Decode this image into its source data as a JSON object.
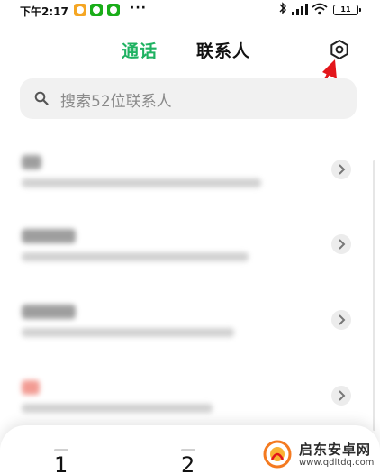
{
  "status_bar": {
    "time": "下午2:17",
    "more": "···",
    "battery": "11",
    "app_badges": [
      {
        "icon": "app-notification-icon",
        "color": "#f5a623"
      },
      {
        "icon": "wechat-icon",
        "color": "#1aad19"
      },
      {
        "icon": "wechat-icon",
        "color": "#1aad19"
      }
    ]
  },
  "header": {
    "tabs": [
      {
        "label": "通话",
        "active": true
      },
      {
        "label": "联系人",
        "active": false
      }
    ],
    "settings_icon": "settings-icon"
  },
  "search": {
    "placeholder": "搜索52位联系人"
  },
  "contacts": [
    {
      "icon": "chevron-right-icon"
    },
    {
      "icon": "chevron-right-icon"
    },
    {
      "icon": "chevron-right-icon"
    },
    {
      "icon": "chevron-right-icon"
    }
  ],
  "dialpad": {
    "keys": [
      "1",
      "2"
    ]
  },
  "watermark": {
    "title": "启东安卓网",
    "url": "www.qdltdq.com"
  },
  "colors": {
    "accent": "#1fb262",
    "annotation": "#e3161b"
  }
}
